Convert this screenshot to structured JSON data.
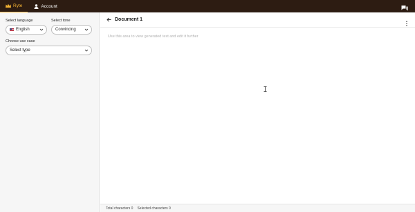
{
  "topbar": {
    "tabs": [
      {
        "label": "Ryte",
        "icon": "crown-icon",
        "active": true
      },
      {
        "label": "Account",
        "icon": "person-icon",
        "active": false
      }
    ],
    "chat_icon": "chat-icon"
  },
  "sidebar": {
    "language_label": "Select language",
    "language_value": "English",
    "tone_label": "Select tone",
    "tone_value": "Convincing",
    "use_case_label": "Choose use case",
    "use_case_value": "Select type"
  },
  "document": {
    "title": "Document 1",
    "placeholder": "Use this area to view generated text and edit it further"
  },
  "footer": {
    "total_characters": "Total characters 0",
    "selected_characters": "Selected characters 0"
  },
  "colors": {
    "topbar_bg": "#2d1c12",
    "accent": "#f2b233"
  }
}
